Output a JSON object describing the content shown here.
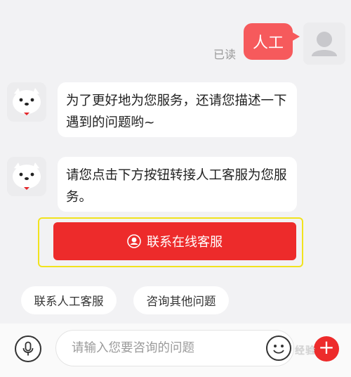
{
  "user_message": {
    "text": "人工",
    "status": "已读"
  },
  "bot_messages": [
    {
      "text": "为了更好地为您服务，还请您描述一下遇到的问题哟~"
    },
    {
      "text": "请您点击下方按钮转接人工客服为您服务。"
    }
  ],
  "contact_button": {
    "label": "联系在线客服",
    "icon": "headset-icon"
  },
  "quick_replies": [
    {
      "label": "联系人工客服"
    },
    {
      "label": "咨询其他问题"
    }
  ],
  "input": {
    "placeholder": "请输入您要咨询的问题"
  },
  "watermark": {
    "text": "经验"
  },
  "colors": {
    "accent": "#ed2b2b",
    "user_bubble": "#f65a5c",
    "highlight_border": "#f1e31d",
    "background": "#f2f2f4"
  }
}
